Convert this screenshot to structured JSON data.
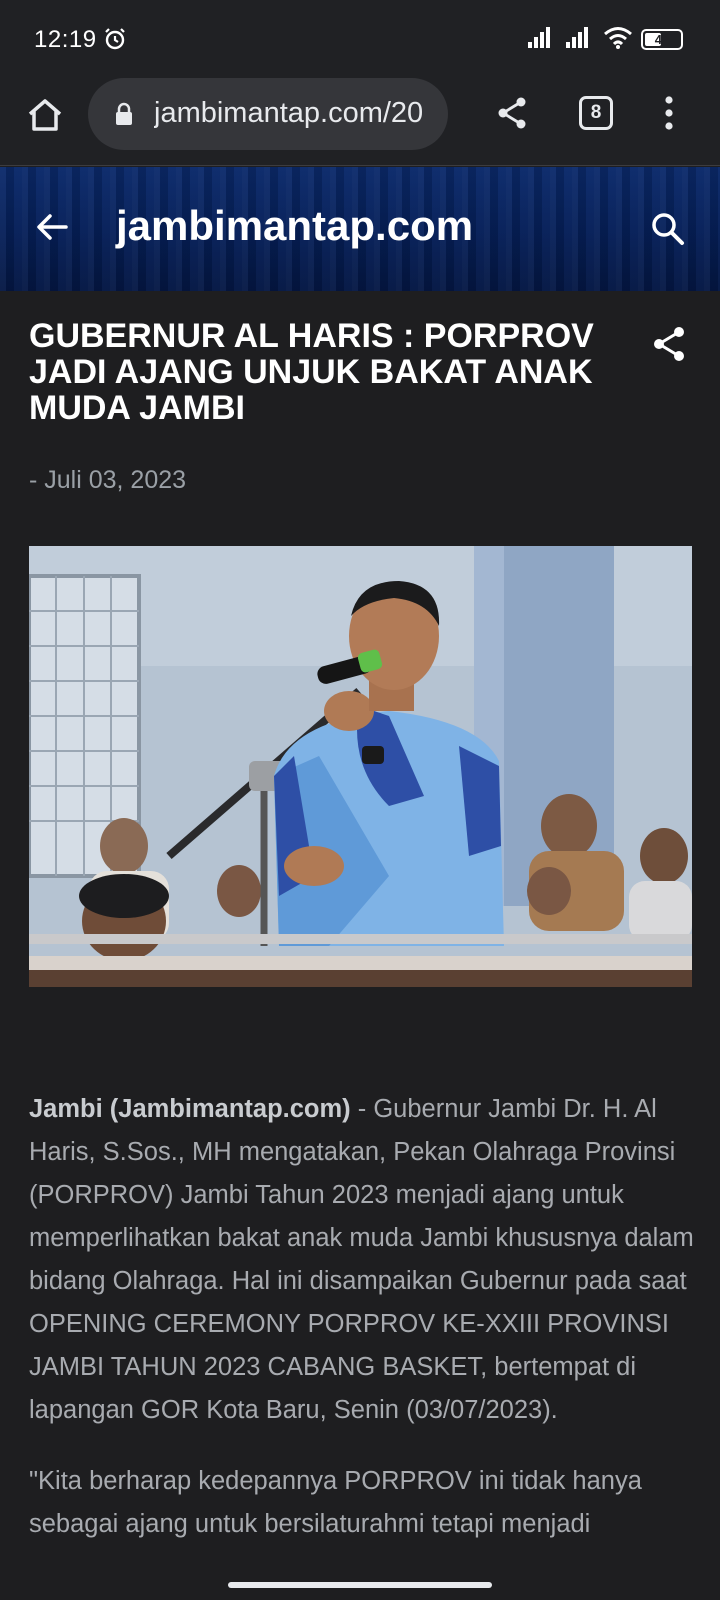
{
  "status_bar": {
    "time": "12:19",
    "battery": "42",
    "battery_level": 0.42,
    "icons": [
      "alarm-icon",
      "signal-icon",
      "signal-icon",
      "wifi-icon",
      "battery-icon"
    ]
  },
  "browser": {
    "url": "jambimantap.com/20",
    "tab_count": "8",
    "icons": [
      "home-icon",
      "lock-icon",
      "share-icon",
      "tabs-icon",
      "more-vert-icon"
    ]
  },
  "blog_header": {
    "title": "jambimantap.com",
    "icons": [
      "back-arrow-icon",
      "search-icon"
    ]
  },
  "post": {
    "title": "GUBERNUR AL HARIS : PORPROV JADI AJANG UNJUK BAKAT ANAK MUDA JAMBI",
    "date": "- Juli 03, 2023",
    "share_icon": "share-icon",
    "image_alt": "Gubernur berbicara di mikrofon",
    "lead_bold": "Jambi (Jambimantap.com)",
    "paragraph_1_rest": " - Gubernur Jambi Dr. H. Al Haris, S.Sos., MH mengatakan, Pekan Olahraga Provinsi (PORPROV) Jambi Tahun 2023 menjadi ajang untuk memperlihatkan bakat anak muda Jambi khususnya dalam bidang Olahraga. Hal ini disampaikan Gubernur pada saat OPENING CEREMONY PORPROV KE-XXIII PROVINSI JAMBI TAHUN 2023 CABANG BASKET, bertempat di lapangan GOR Kota Baru, Senin (03/07/2023).",
    "paragraph_2": "\"Kita berharap kedepannya PORPROV ini tidak hanya sebagai ajang untuk bersilaturahmi tetapi menjadi"
  },
  "colors": {
    "background": "#1e1e20",
    "toolbar": "#202124",
    "header_blue": "#06205a",
    "body_text": "#a8abb0"
  }
}
